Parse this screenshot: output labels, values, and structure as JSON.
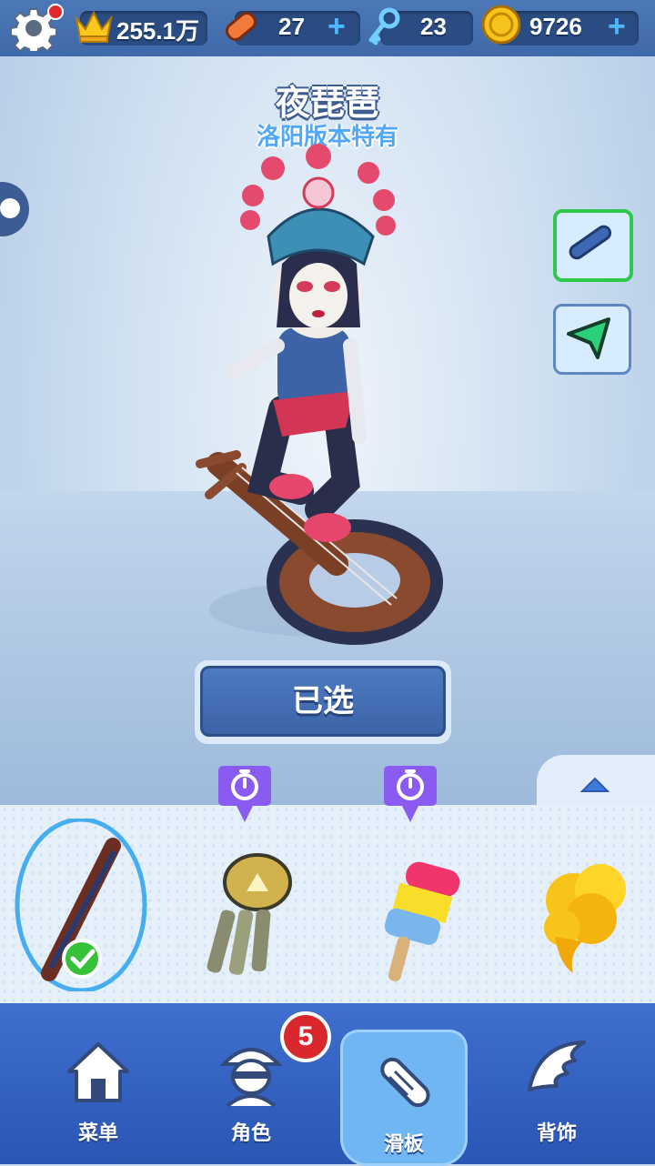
{
  "currency": {
    "score": "255.1万",
    "hoverboards": "27",
    "keys": "23",
    "coins": "9726"
  },
  "item": {
    "name": "夜琵琶",
    "note": "洛阳版本特有"
  },
  "select_button": "已选",
  "badge_count": "5",
  "nav": [
    {
      "label": "菜单",
      "icon": "home-icon"
    },
    {
      "label": "角色",
      "icon": "character-icon"
    },
    {
      "label": "滑板",
      "icon": "hoverboard-icon"
    },
    {
      "label": "背饰",
      "icon": "wings-icon"
    }
  ],
  "nav_active": "滑板",
  "colors": {
    "topbar": "#4d78b8",
    "accent_blue": "#52a8f5",
    "nav_bg": "#2a56b4",
    "timer_badge": "#8a5bf0",
    "selected_ring": "#46aef0",
    "check_green": "#35c238"
  }
}
